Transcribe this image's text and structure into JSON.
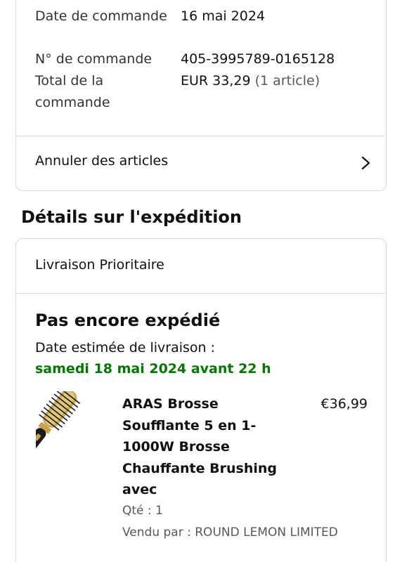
{
  "order_summary": {
    "rows": [
      {
        "label": "Date de commande",
        "value": "16 mai 2024",
        "extra": ""
      },
      {
        "label": "N° de commande",
        "value": "405-3995789-0165128",
        "extra": ""
      },
      {
        "label": "Total de la commande",
        "value": "EUR 33,29",
        "extra": " (1 article)"
      }
    ],
    "cancel_label": "Annuler des articles"
  },
  "shipment": {
    "section_title": "Détails sur l'expédition",
    "method": "Livraison Prioritaire",
    "status": "Pas encore expédié",
    "estimated_label": "Date estimée de livraison :",
    "estimated_date": "samedi 18 mai 2024 avant 22 h",
    "estimated_date_color": "#007600"
  },
  "product": {
    "title": "ARAS Brosse Soufflante 5 en 1-1000W Brosse Chauffante Brushing avec",
    "price": "€36,99",
    "quantity": "Qté : 1",
    "seller_prefix": "Vendu par : ",
    "seller_name": "ROUND LEMON LIMITED",
    "image_icon": "hair-dryer-brush-image"
  }
}
